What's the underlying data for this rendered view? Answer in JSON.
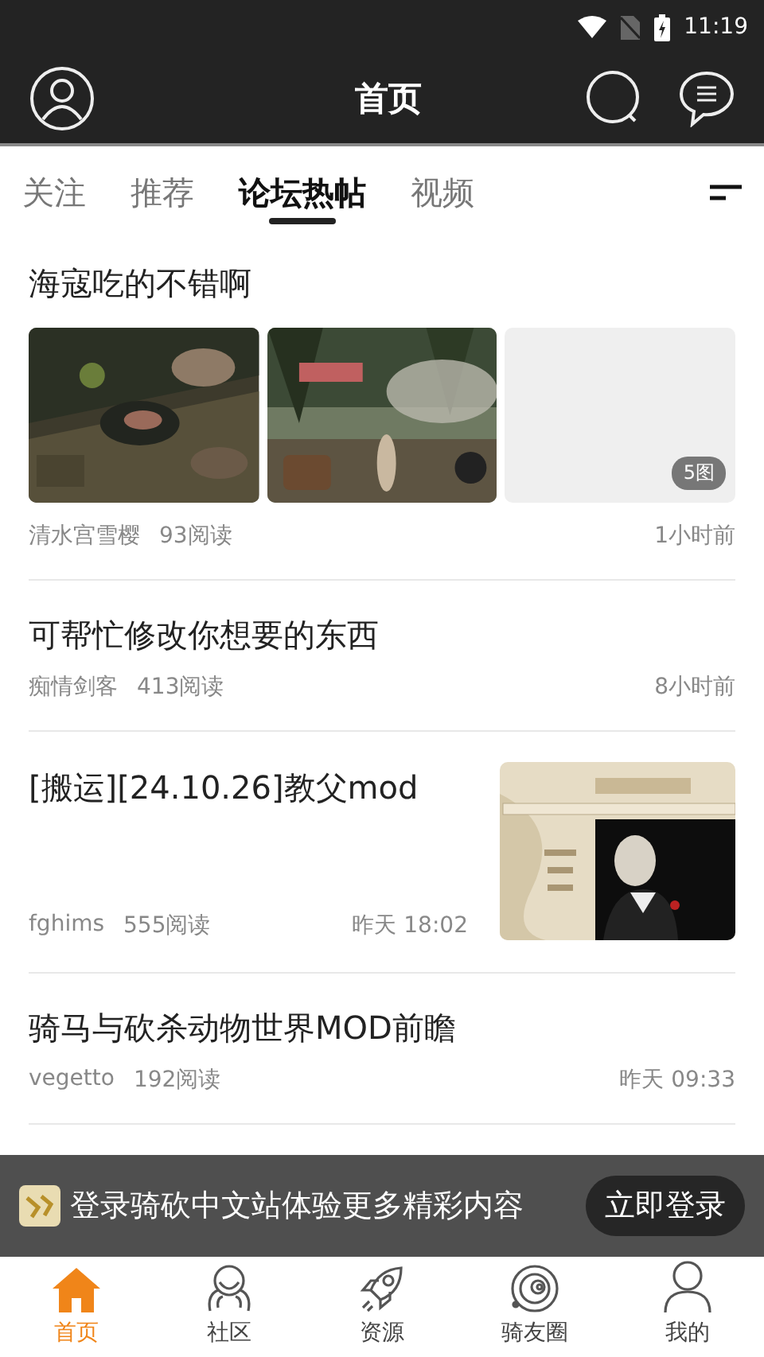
{
  "status_bar": {
    "time": "11:19"
  },
  "header": {
    "title": "首页"
  },
  "tabs": [
    {
      "label": "关注",
      "selected": false
    },
    {
      "label": "推荐",
      "selected": false
    },
    {
      "label": "论坛热帖",
      "selected": true
    },
    {
      "label": "视频",
      "selected": false
    }
  ],
  "posts": [
    {
      "kind": "gallery",
      "title": "海寇吃的不错啊",
      "images": [
        {
          "kind": "picture"
        },
        {
          "kind": "picture"
        },
        {
          "kind": "empty",
          "badge": "5图"
        }
      ],
      "author": "清水宫雪樱",
      "reads": "93阅读",
      "time": "1小时前"
    },
    {
      "kind": "text",
      "title": "可帮忙修改你想要的东西",
      "author": "痴情剑客",
      "reads": "413阅读",
      "time": "8小时前"
    },
    {
      "kind": "thumb",
      "title": "[搬运][24.10.26]教父mod",
      "author": "fghims",
      "reads": "555阅读",
      "time": "昨天 18:02"
    },
    {
      "kind": "text",
      "title": "骑马与砍杀动物世界MOD前瞻",
      "author": "vegetto",
      "reads": "192阅读",
      "time": "昨天 09:33"
    }
  ],
  "login_banner": {
    "text": "登录骑砍中文站体验更多精彩内容",
    "button": "立即登录"
  },
  "bottom_nav": [
    {
      "kind": "home",
      "label": "首页",
      "selected": true
    },
    {
      "kind": "community",
      "label": "社区",
      "selected": false
    },
    {
      "kind": "resources",
      "label": "资源",
      "selected": false
    },
    {
      "kind": "friends",
      "label": "骑友圈",
      "selected": false
    },
    {
      "kind": "me",
      "label": "我的",
      "selected": false
    }
  ]
}
